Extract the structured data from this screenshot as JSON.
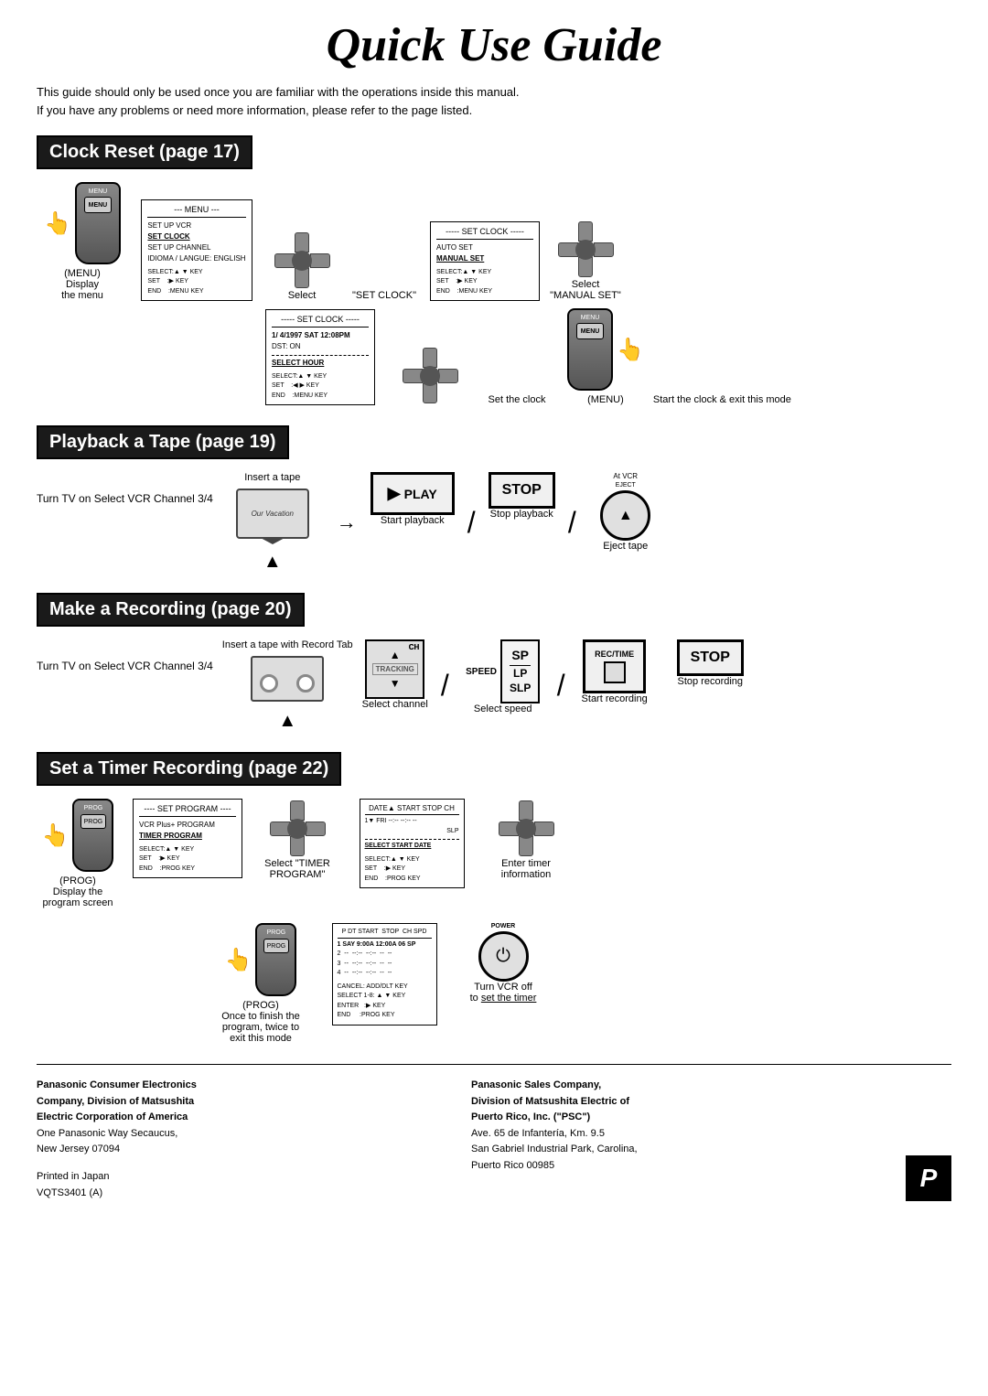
{
  "page": {
    "title": "Quick Use Guide",
    "intro_line1": "This guide should only be used once you are familiar with the operations inside this manual.",
    "intro_line2": "If you have any problems or need more information, please refer to the page listed."
  },
  "sections": {
    "clock": {
      "header": "Clock Reset (page 17)",
      "steps": [
        {
          "id": "display-menu",
          "label": "Display\nthe menu",
          "icon": "hand+remote"
        },
        {
          "id": "menu-box-1",
          "label": "",
          "icon": "menu-box"
        },
        {
          "id": "select-arrow-1",
          "label": "Select",
          "icon": "dpad"
        },
        {
          "id": "set-clock-label",
          "label": "\"SET CLOCK\"",
          "icon": ""
        },
        {
          "id": "set-clock-box",
          "label": "",
          "icon": "set-clock-box"
        },
        {
          "id": "select-arrow-2",
          "label": "",
          "icon": "dpad"
        },
        {
          "id": "set-clock-label2",
          "label": "Set the clock",
          "icon": ""
        },
        {
          "id": "menu-icon-2",
          "label": "",
          "icon": "menu"
        },
        {
          "id": "select-manual",
          "label": "Select\n\"MANUAL SET\"",
          "icon": ""
        },
        {
          "id": "start-clock",
          "label": "Start the clock &\nexit this mode",
          "icon": ""
        }
      ],
      "menu_box_1": {
        "title": "--- MENU ---",
        "items": [
          "SET UP VCR",
          "SET CLOCK",
          "SET UP CHANNEL",
          "IDIOMA / LANGUE: ENGLISH"
        ],
        "selected": "SET CLOCK",
        "footer": "SELECT:▲ ▼ KEY\nSET    :▶ KEY\nEND    :MENU KEY"
      },
      "select_label_1": "Select",
      "set_clock_label": "\"SET CLOCK\"",
      "set_clock_box": {
        "title": "----- SET CLOCK -----",
        "items": [
          "AUTO SET",
          "MANUAL SET"
        ],
        "footer": "SELECT:▲ ▼ KEY\nSET    :▶ KEY\nEND    :MENU KEY"
      },
      "set_clock_entry": {
        "title": "----- SET CLOCK -----",
        "line1": "1/ 4/1997 SAT 12:08PM",
        "line2": "DST: ON",
        "selected": "SELECT HOUR",
        "footer": "SELECT:▲ ▼ KEY\nSET    :◀ ▶ KEY\nEND    :MENU KEY"
      },
      "select_label_2": "Select",
      "manual_set_label": "\"MANUAL SET\"",
      "set_clock_text": "Set the clock",
      "start_clock_text": "Start the clock &\nexit this mode"
    },
    "playback": {
      "header": "Playback a Tape (page 19)",
      "left_label": "Turn TV on\nSelect VCR\nChannel 3/4",
      "insert_label": "Insert a tape",
      "play_label": "Start playback",
      "stop_label": "Stop playback",
      "eject_label": "Eject tape",
      "at_vcr": "At VCR",
      "eject_key": "EJECT"
    },
    "recording": {
      "header": "Make a Recording (page 20)",
      "left_label": "Turn TV on\nSelect VCR\nChannel 3/4",
      "insert_label": "Insert a tape\nwith Record Tab",
      "channel_label": "Select channel",
      "speed_label": "Select speed",
      "rec_label": "Start recording",
      "stop_label": "Stop recording",
      "speed_options": "SP\nLP\nSLP",
      "speed_prefix": "SPEED"
    },
    "timer": {
      "header": "Set a Timer Recording (page 22)",
      "prog_label": "(PROG)",
      "display_label": "Display the\nprogram screen",
      "select_timer_label": "Select\n\"TIMER PROGRAM\"",
      "enter_timer_label": "Enter timer information",
      "finish_label": "Once to finish the program,\ntwice to exit this mode",
      "turn_off_label": "Turn VCR off\nto set the timer",
      "power_label": "POWER",
      "menu_set_program": {
        "title": "---- SET PROGRAM ----",
        "items": [
          "VCR Plus+ PROGRAM",
          "TIMER PROGRAM"
        ],
        "selected": "TIMER PROGRAM",
        "footer": "SELECT:▲ ▼ KEY\nSET    :▶ KEY\nEND    :PROG KEY"
      },
      "timer_box": {
        "title": "DATE▲  START  STOP  CH",
        "line1": "1▼ FRI  --:--  --:--  --",
        "line2": "               SLP",
        "selected": "SELECT START DATE",
        "footer": "SELECT:▲ ▼ KEY\nSET    :▶ KEY\nEND    :PROG KEY"
      },
      "timer_list_box": {
        "title": "P DT START  STOP  CH SPD",
        "rows": [
          "1 SAY 9:00A 12:00A 06 SP",
          "2  --  --:--  --:--  --  --",
          "3  --  --:--  --:--  --  --",
          "4  --  --:--  --:--  --  --"
        ],
        "footer": "CANCEL: ADD/DLT KEY\nSELECT 1-8: A ▼ KEY\nENTER  :▶ KEY\nEND    :PROG KEY"
      }
    }
  },
  "footer": {
    "col1": {
      "company": "Panasonic Consumer Electronics\nCompany, Division of Matsushita\nElectric Corporation of America",
      "address": "One Panasonic Way Secaucus,\nNew Jersey 07094"
    },
    "col2": {
      "company": "Panasonic Sales Company,\nDivision of Matsushita Electric of\nPuerto Rico, Inc. (\"PSC\")",
      "address": "Ave. 65 de Infantería, Km. 9.5\nSan Gabriel Industrial Park, Carolina,\nPuerto Rico 00985"
    },
    "printed": "Printed in Japan",
    "model": "VQTS3401 (A)",
    "logo": "P"
  }
}
